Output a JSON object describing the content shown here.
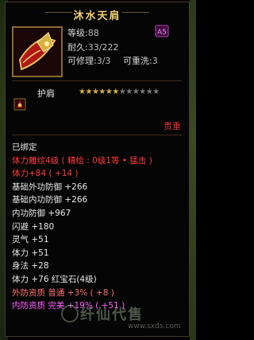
{
  "item": {
    "name": "沐水天肩",
    "level_label": "等级:",
    "level_value": "88",
    "durability_label": "耐久:",
    "durability_value": "33/222",
    "repair_label": "可修理:",
    "repair_value": "3/3",
    "rewash_label": "可重洗:",
    "rewash_value": "3",
    "slot": "护肩",
    "stars_on": 6,
    "stars_total": 12,
    "precious": "贵重"
  },
  "attributes": [
    {
      "text": "已绑定",
      "color": "white"
    },
    {
      "text": "体力雕纹4级 ( 精绘 : 0级1等 • 猛击 )",
      "color": "red"
    },
    {
      "text": "体力+84 ( +14 )",
      "color": "red"
    },
    {
      "text": "基础外功防御 +266",
      "color": "white"
    },
    {
      "text": "基础内功防御 +266",
      "color": "white"
    },
    {
      "text": "内功防御 +967",
      "color": "white"
    },
    {
      "text": "闪避 +180",
      "color": "white"
    },
    {
      "text": "灵气 +51",
      "color": "white"
    },
    {
      "text": "体力 +51",
      "color": "white"
    },
    {
      "text": "身法 +28",
      "color": "white"
    },
    {
      "text": "体力 +76 红宝石(4级)",
      "color": "white"
    },
    {
      "text": "外防资质   普通 +3% ( +8 )",
      "color": "pink"
    },
    {
      "text": "内防资质   完美 +19% ( +51 )",
      "color": "magenta"
    }
  ],
  "watermark": {
    "text": "纤仙代售",
    "url": "www.sxds.com"
  },
  "colors": {
    "title": "#f0d070",
    "red": "#ff3b3b",
    "frame": "#8a6a30"
  }
}
